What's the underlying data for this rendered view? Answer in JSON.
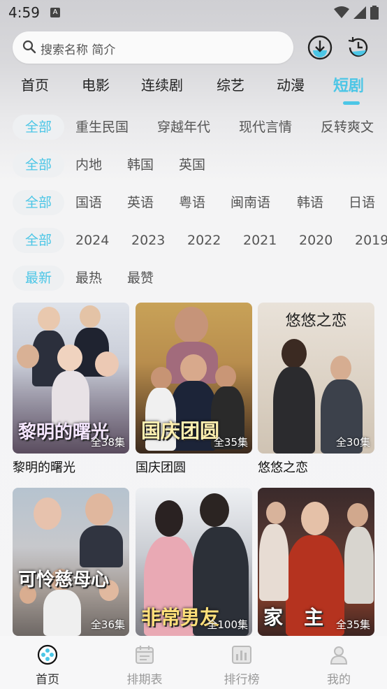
{
  "status": {
    "time": "4:59",
    "notif_icon": "A"
  },
  "search": {
    "placeholder": "搜索名称 简介"
  },
  "tabs": [
    "首页",
    "电影",
    "连续剧",
    "综艺",
    "动漫",
    "短剧"
  ],
  "filters": {
    "genre": [
      "全部",
      "重生民国",
      "穿越年代",
      "现代言情",
      "反转爽文"
    ],
    "region": [
      "全部",
      "内地",
      "韩国",
      "英国"
    ],
    "language": [
      "全部",
      "国语",
      "英语",
      "粤语",
      "闽南语",
      "韩语",
      "日语"
    ],
    "year": [
      "全部",
      "2024",
      "2023",
      "2022",
      "2021",
      "2020",
      "2019"
    ],
    "sort": [
      "最新",
      "最热",
      "最赞"
    ]
  },
  "cards": [
    {
      "title": "黎明的曙光",
      "episodes": "全38集",
      "poster_text": "黎明的曙光"
    },
    {
      "title": "国庆团圆",
      "episodes": "全35集",
      "poster_text": "国庆团圆"
    },
    {
      "title": "悠悠之恋",
      "episodes": "全30集",
      "poster_text": "悠悠之恋"
    },
    {
      "title": "",
      "episodes": "全36集",
      "poster_text": "可怜慈母心"
    },
    {
      "title": "",
      "episodes": "全100集",
      "poster_text": "非常男友"
    },
    {
      "title": "",
      "episodes": "全35集",
      "poster_text": "家主"
    }
  ],
  "nav": [
    {
      "label": "首页",
      "icon": "home-film-icon"
    },
    {
      "label": "排期表",
      "icon": "calendar-icon"
    },
    {
      "label": "排行榜",
      "icon": "chart-icon"
    },
    {
      "label": "我的",
      "icon": "profile-icon"
    }
  ],
  "colors": {
    "accent": "#4cc6e6"
  }
}
